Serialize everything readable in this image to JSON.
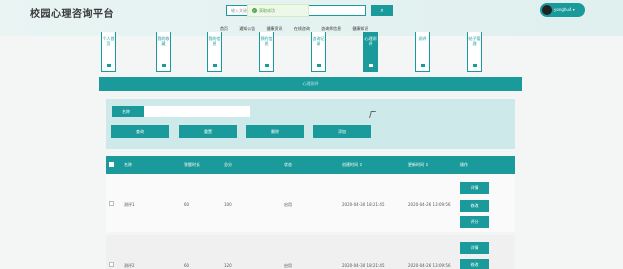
{
  "app": {
    "title": "校园心理咨询平台",
    "user": "yonghu4",
    "user_caret": "▾"
  },
  "search": {
    "placeholder": "输入关键字",
    "button": "⌕"
  },
  "toast": {
    "icon": "✓",
    "message": "获取成功"
  },
  "nav": [
    "首页",
    "通知公告",
    "健康资讯",
    "在线咨询",
    "咨询师信息",
    "健康知识"
  ],
  "tiles": [
    {
      "label": "个人首页"
    },
    {
      "label": "我的收藏"
    },
    {
      "label": "我的信息"
    },
    {
      "label": "预约信息"
    },
    {
      "label": "咨询记录"
    },
    {
      "label": "心理测评"
    },
    {
      "label": "测评"
    },
    {
      "label": "帖子管理"
    }
  ],
  "banner": "心理测评",
  "filter": {
    "name_label": "名称",
    "name_value": "",
    "buttons": [
      "查询",
      "重置",
      "删除",
      "添加"
    ]
  },
  "table": {
    "columns": [
      "名称",
      "答题时长",
      "总分",
      "状态",
      "创建时间 ⇕",
      "更新时间 ⇕",
      "操作"
    ],
    "rows": [
      {
        "name": "测评1",
        "duration": "60",
        "score": "100",
        "status": "启用",
        "created": "2020-04-30 18:21:45",
        "updated": "2020-04-26 13:09:56",
        "actions": [
          "详情",
          "修改",
          "评分"
        ]
      },
      {
        "name": "测评2",
        "duration": "60",
        "score": "120",
        "status": "启用",
        "created": "2020-04-30 18:21:45",
        "updated": "2020-04-26 13:09:56",
        "actions": [
          "详情",
          "修改"
        ]
      }
    ]
  },
  "colors": {
    "accent": "#1a9a9a",
    "panel": "#cde9e9"
  }
}
